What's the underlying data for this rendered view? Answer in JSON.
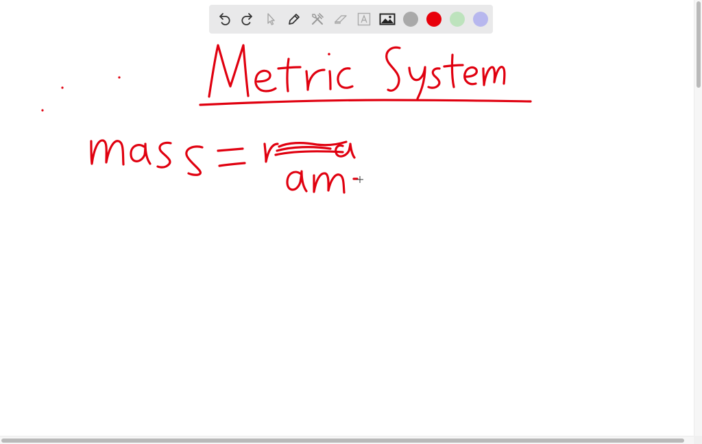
{
  "toolbar": {
    "tools": [
      {
        "name": "undo-icon"
      },
      {
        "name": "redo-icon"
      },
      {
        "name": "select-pointer-icon"
      },
      {
        "name": "pen-icon"
      },
      {
        "name": "tools-icon"
      },
      {
        "name": "eraser-icon"
      },
      {
        "name": "text-icon"
      },
      {
        "name": "image-icon"
      }
    ],
    "colors": [
      {
        "name": "gray",
        "hex": "#a9a9a9"
      },
      {
        "name": "red",
        "hex": "#e8000b"
      },
      {
        "name": "green",
        "hex": "#bde3bd"
      },
      {
        "name": "purple",
        "hex": "#b7b7ee"
      }
    ]
  },
  "canvas": {
    "ink_color": "#e0000f",
    "handwriting": [
      {
        "id": "title",
        "text": "Metric System"
      },
      {
        "id": "line1",
        "text": "mass ="
      },
      {
        "id": "line2",
        "text": "am"
      }
    ]
  }
}
